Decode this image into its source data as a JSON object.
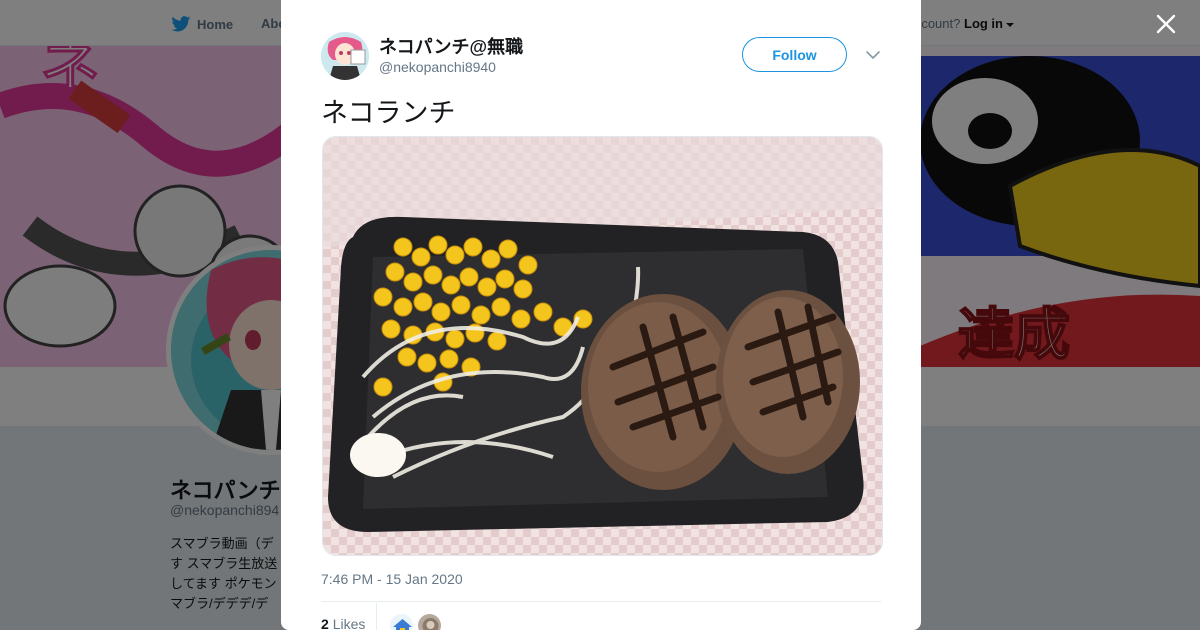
{
  "nav": {
    "home_label": "Home",
    "about_label": "Abo",
    "account_prompt": "ccount?",
    "login_label": "Log in"
  },
  "background_profile": {
    "name": "ネコパンチ",
    "handle": "@nekopanchi894",
    "bio_lines": [
      "スマブラ動画（デ",
      "す スマブラ生放送",
      "してます ポケモン",
      "マブラ/デデデ/デ"
    ],
    "banner_text": "達成"
  },
  "tweet": {
    "author_name": "ネコパンチ@無職",
    "author_handle": "@nekopanchi8940",
    "follow_label": "Follow",
    "text": "ネコランチ",
    "timestamp": "7:46 PM - 15 Jan 2020",
    "likes_count": "2",
    "likes_label": "Likes"
  },
  "colors": {
    "brand_blue": "#1b95e0",
    "twitter_blue": "#1da1f2",
    "secondary_text": "#657786"
  },
  "icons": {
    "nav_home": "twitter-bird-icon",
    "close": "close-icon",
    "menu": "chevron-down-icon"
  }
}
